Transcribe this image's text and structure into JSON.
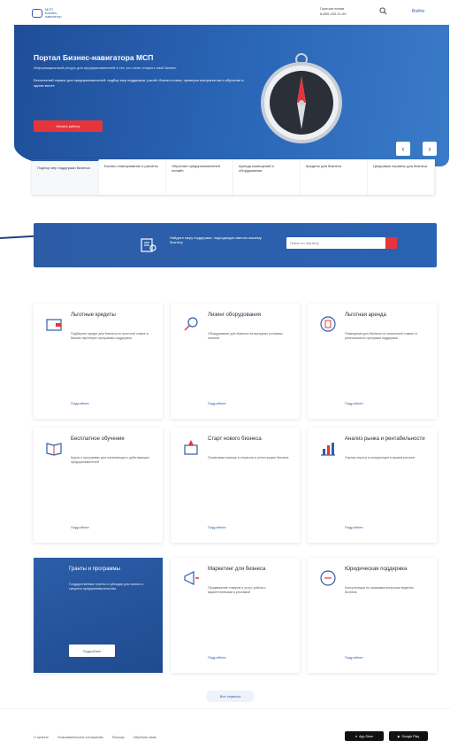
{
  "header": {
    "logo_text": "МСП Бизнес-навигатор",
    "phone": "8-800-100-11-00",
    "contact_label": "Горячая линия",
    "login_label": "Войти"
  },
  "hero": {
    "title": "Портал Бизнес-навигатора МСП",
    "subtitle": "Информационный ресурс для предпринимателей и тех, кто хочет открыть свой бизнес",
    "description": "Бесплатный сервис для предпринимателей: подбор мер поддержки, расчёт бизнес-плана, проверка контрагентов и обучение в одном месте",
    "button_label": "Начать работу",
    "prev_label": "‹",
    "next_label": "›"
  },
  "tabs": [
    {
      "label": "Подбор мер поддержки бизнеса"
    },
    {
      "label": "Бизнес-планирование и расчёты"
    },
    {
      "label": "Обучение предпринимателей онлайн"
    },
    {
      "label": "Аренда помещений и оборудования"
    },
    {
      "label": "Кредиты для бизнеса"
    },
    {
      "label": "Цифровые сервисы для бизнеса"
    }
  ],
  "search": {
    "text": "Найдите меру поддержки, подходящую именно вашему бизнесу",
    "placeholder": "Поиск по порталу"
  },
  "cards": [
    {
      "title": "Льготные кредиты",
      "text": "Подберите кредит для бизнеса по льготной ставке в банках-партнёрах программы поддержки",
      "more": "Подробнее"
    },
    {
      "title": "Лизинг оборудования",
      "text": "Оборудование для бизнеса на выгодных условиях лизинга",
      "more": "Подробнее"
    },
    {
      "title": "Льготная аренда",
      "text": "Помещения для бизнеса по сниженной ставке от региональных программ поддержки",
      "more": "Подробнее"
    },
    {
      "title": "Бесплатное обучение",
      "text": "Курсы и программы для начинающих и действующих предпринимателей",
      "more": "Подробнее"
    },
    {
      "title": "Старт нового бизнеса",
      "text": "Пошаговая помощь в открытии и регистрации бизнеса",
      "more": "Подробнее"
    },
    {
      "title": "Анализ рынка и рентабельности",
      "text": "Оценка спроса и конкуренции в вашем регионе",
      "more": "Подробнее"
    },
    {
      "title": "Гранты и программы",
      "text": "Государственные гранты и субсидии для малого и среднего предпринимательства",
      "more": "Подробнее"
    },
    {
      "title": "Маркетинг для бизнеса",
      "text": "Продвижение товаров и услуг, работа с маркетплейсами и рекламой",
      "more": "Подробнее"
    },
    {
      "title": "Юридическая поддержка",
      "text": "Консультации по правовым вопросам ведения бизнеса",
      "more": "Подробнее"
    }
  ],
  "all_services_label": "Все сервисы",
  "footer": {
    "links": [
      "О проекте",
      "Пользовательское соглашение",
      "Помощь",
      "Обратная связь"
    ],
    "app_store_label": "App Store",
    "google_play_label": "Google Play"
  }
}
